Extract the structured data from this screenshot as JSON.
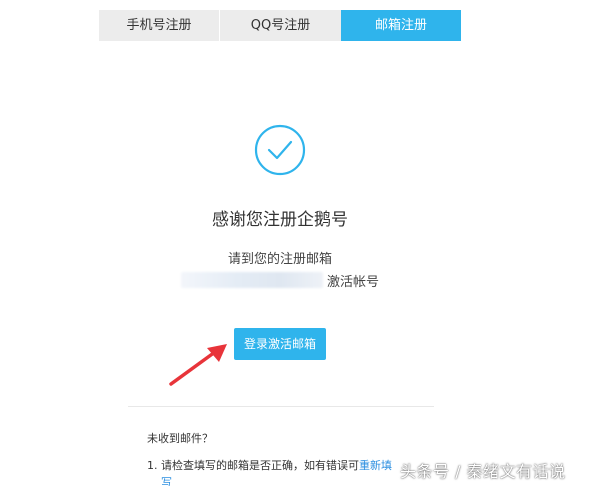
{
  "tabs": [
    {
      "label": "手机号注册",
      "active": false
    },
    {
      "label": "QQ号注册",
      "active": false
    },
    {
      "label": "邮箱注册",
      "active": true
    }
  ],
  "colors": {
    "accent": "#2fb4ec",
    "link": "#2c8fe0",
    "arrow": "#e8343a"
  },
  "success": {
    "icon": "check-circle-icon",
    "title": "感谢您注册企鹅号",
    "line1": "请到您的注册邮箱",
    "line2_suffix": "激活帐号"
  },
  "button": {
    "label": "登录激活邮箱"
  },
  "faq": {
    "title": "未收到邮件？",
    "item1_prefix": "1. 请检查填写的邮箱是否正确，如有错误可",
    "item1_link": "重新填",
    "item1_link_cont": "写"
  },
  "watermark": "头条号 / 秦绪文有话说"
}
